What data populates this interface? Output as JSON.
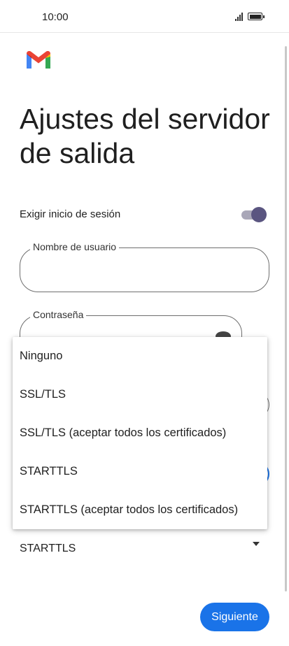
{
  "status_bar": {
    "time": "10:00",
    "signal_icon": "signal-icon",
    "battery_icon": "battery-icon"
  },
  "app": {
    "logo_icon": "gmail-logo-icon"
  },
  "page": {
    "title": "Ajustes del servidor de salida"
  },
  "login_required": {
    "label": "Exigir inicio de sesión",
    "enabled": true
  },
  "username_field": {
    "label": "Nombre de usuario",
    "value": ""
  },
  "password_field": {
    "label": "Contraseña",
    "value": "",
    "icon": "visibility-icon"
  },
  "security_select": {
    "selected": "STARTTLS",
    "options": [
      "Ninguno",
      "SSL/TLS",
      "SSL/TLS (aceptar todos los certificados)",
      "STARTTLS",
      "STARTTLS (aceptar todos los certificados)"
    ]
  },
  "footer": {
    "next_label": "Siguiente"
  },
  "colors": {
    "accent": "#1a73e8",
    "toggle_thumb": "#5a5580",
    "toggle_track": "#a9a7b8"
  }
}
